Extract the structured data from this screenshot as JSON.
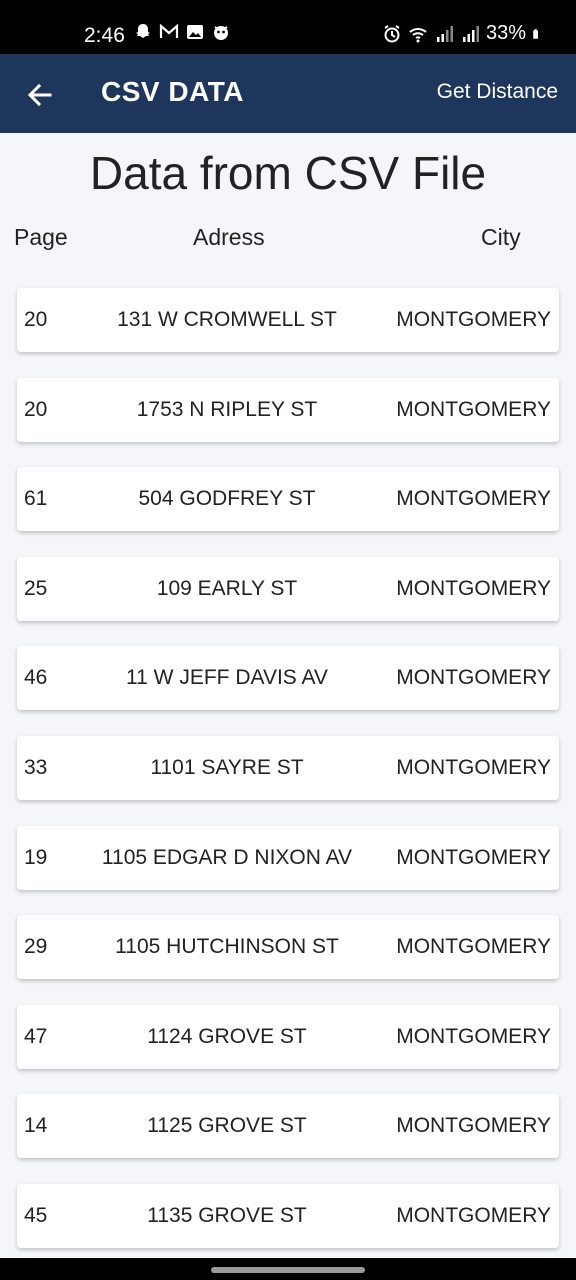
{
  "status_bar": {
    "time": "2:46",
    "battery": "33%",
    "left_icons": [
      "snapchat-icon",
      "gmail-icon",
      "gallery-icon",
      "app-icon"
    ],
    "right_icons": [
      "alarm-icon",
      "wifi-icon",
      "signal-icon",
      "signal-icon",
      "battery-icon"
    ]
  },
  "app_bar": {
    "title": "CSV DATA",
    "action_label": "Get Distance",
    "background": "#1e365b"
  },
  "heading": "Data from CSV File",
  "columns": {
    "page": "Page",
    "address": "Adress",
    "city": "City"
  },
  "rows": [
    {
      "page": "20",
      "address": "131 W CROMWELL ST",
      "city": "MONTGOMERY"
    },
    {
      "page": "20",
      "address": "1753 N RIPLEY ST",
      "city": "MONTGOMERY"
    },
    {
      "page": "61",
      "address": "504 GODFREY ST",
      "city": "MONTGOMERY"
    },
    {
      "page": "25",
      "address": "109 EARLY ST",
      "city": "MONTGOMERY"
    },
    {
      "page": "46",
      "address": "11 W JEFF DAVIS AV",
      "city": "MONTGOMERY"
    },
    {
      "page": "33",
      "address": "1101 SAYRE ST",
      "city": "MONTGOMERY"
    },
    {
      "page": "19",
      "address": "1105 EDGAR D NIXON AV",
      "city": "MONTGOMERY"
    },
    {
      "page": "29",
      "address": "1105 HUTCHINSON ST",
      "city": "MONTGOMERY"
    },
    {
      "page": "47",
      "address": "1124 GROVE ST",
      "city": "MONTGOMERY"
    },
    {
      "page": "14",
      "address": "1125 GROVE ST",
      "city": "MONTGOMERY"
    },
    {
      "page": "45",
      "address": "1135 GROVE ST",
      "city": "MONTGOMERY"
    }
  ]
}
